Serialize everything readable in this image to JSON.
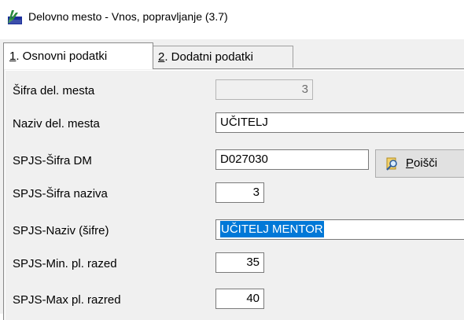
{
  "window": {
    "title": "Delovno mesto - Vnos, popravljanje  (3.7)",
    "app_icon": "plus-app-icon"
  },
  "tabs": [
    {
      "hotkey": "1",
      "label": ". Osnovni podatki",
      "active": true
    },
    {
      "hotkey": "2",
      "label": ". Dodatni podatki",
      "active": false
    }
  ],
  "form": {
    "sifra_del_mesta": {
      "label": "Šifra del. mesta",
      "value": "3"
    },
    "naziv_del_mesta": {
      "label": "Naziv del. mesta",
      "value": "UČITELJ"
    },
    "spjs_sifra_dm": {
      "label": "SPJS-Šifra DM",
      "value": "D027030"
    },
    "spjs_sifra_naziva": {
      "label": "SPJS-Šifra naziva",
      "value": "3"
    },
    "spjs_naziv_sifre": {
      "label": "SPJS-Naziv (šifre)",
      "value": "UČITELJ MENTOR"
    },
    "spjs_min_razred": {
      "label": "SPJS-Min. pl. razed",
      "value": "35"
    },
    "spjs_max_razred": {
      "label": "SPJS-Max pl. razred",
      "value": "40"
    }
  },
  "search_button": {
    "hotkey": "P",
    "label": "oišči",
    "icon": "search-icon"
  },
  "colors": {
    "selection": "#0078d7",
    "panel": "#f0f0f0",
    "titlebar": "#ffffff"
  }
}
